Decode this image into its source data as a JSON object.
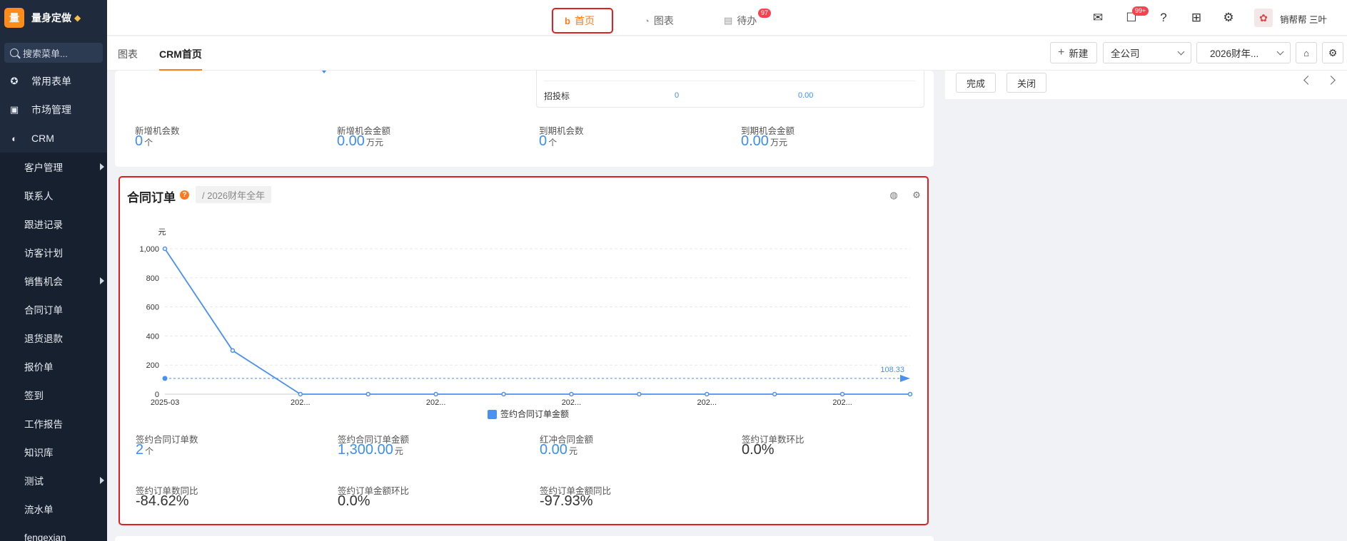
{
  "brand": {
    "logo_char": "量",
    "name": "量身定做"
  },
  "search": {
    "placeholder": "搜索菜单..."
  },
  "sidebar": {
    "top_items": [
      {
        "label": "常用表单",
        "icon": "star-icon"
      },
      {
        "label": "市场管理",
        "icon": "clipboard-icon"
      },
      {
        "label": "CRM",
        "icon": "pie-icon"
      }
    ],
    "crm_items": [
      {
        "label": "客户管理",
        "has_submenu": true
      },
      {
        "label": "联系人",
        "has_submenu": false
      },
      {
        "label": "跟进记录",
        "has_submenu": false
      },
      {
        "label": "访客计划",
        "has_submenu": false
      },
      {
        "label": "销售机会",
        "has_submenu": true
      },
      {
        "label": "合同订单",
        "has_submenu": false
      },
      {
        "label": "退货退款",
        "has_submenu": false
      },
      {
        "label": "报价单",
        "has_submenu": false
      },
      {
        "label": "签到",
        "has_submenu": false
      },
      {
        "label": "工作报告",
        "has_submenu": false
      },
      {
        "label": "知识库",
        "has_submenu": false
      },
      {
        "label": "测试",
        "has_submenu": true
      },
      {
        "label": "流水单",
        "has_submenu": false
      },
      {
        "label": "fengexian",
        "has_submenu": false
      }
    ]
  },
  "topnav": {
    "tabs": [
      {
        "label": "首页",
        "active": true
      },
      {
        "label": "图表",
        "active": false
      },
      {
        "label": "待办",
        "active": false,
        "badge": "97"
      }
    ],
    "chat_badge": "99+",
    "user_name": "销帮帮 三叶"
  },
  "subnav": {
    "tabs": [
      {
        "label": "图表",
        "active": false
      },
      {
        "label": "CRM首页",
        "active": true
      }
    ],
    "new_button": "新建",
    "company_select": "全公司",
    "period_select": "2026财年..."
  },
  "right_panel": {
    "done_label": "完成",
    "close_label": "关闭"
  },
  "opportunity": {
    "bid_row": {
      "label": "招投标",
      "count": "0",
      "amount": "0.00"
    },
    "stats": [
      {
        "label": "新增机会数",
        "value": "0",
        "unit": "个"
      },
      {
        "label": "新增机会金额",
        "value": "0.00",
        "unit": "万元"
      },
      {
        "label": "到期机会数",
        "value": "0",
        "unit": "个"
      },
      {
        "label": "到期机会金额",
        "value": "0.00",
        "unit": "万元"
      }
    ]
  },
  "contract": {
    "title": "合同订单",
    "period": "/ 2026财年全年",
    "stats": [
      {
        "label": "签约合同订单数",
        "value": "2",
        "unit": "个",
        "highlight": true
      },
      {
        "label": "签约合同订单金额",
        "value": "1,300.00",
        "unit": "元",
        "highlight": true
      },
      {
        "label": "红冲合同金额",
        "value": "0.00",
        "unit": "元",
        "highlight": true
      },
      {
        "label": "签约订单数环比",
        "value": "0.0%",
        "unit": "",
        "highlight": false
      },
      {
        "label": "签约订单数同比",
        "value": "-84.62%",
        "unit": "",
        "highlight": false
      },
      {
        "label": "签约订单金额环比",
        "value": "0.0%",
        "unit": "",
        "highlight": false
      },
      {
        "label": "签约订单金额同比",
        "value": "-97.93%",
        "unit": "",
        "highlight": false
      }
    ]
  },
  "chart_data": {
    "type": "line",
    "ylabel": "元",
    "ylim": [
      0,
      1000
    ],
    "yticks": [
      "0",
      "200",
      "400",
      "600",
      "800",
      "1,000"
    ],
    "x_tick_labels": [
      "2025-03",
      "202...",
      "202...",
      "202...",
      "202...",
      "202..."
    ],
    "series": [
      {
        "name": "签约合同订单金额",
        "values": [
          1000,
          300,
          0,
          0,
          0,
          0,
          0,
          0,
          0,
          0,
          0,
          0
        ]
      }
    ],
    "average_line": {
      "value": 108.33,
      "label": "108.33"
    },
    "legend": "bottom",
    "grid": true,
    "color": "#4a90f0"
  }
}
